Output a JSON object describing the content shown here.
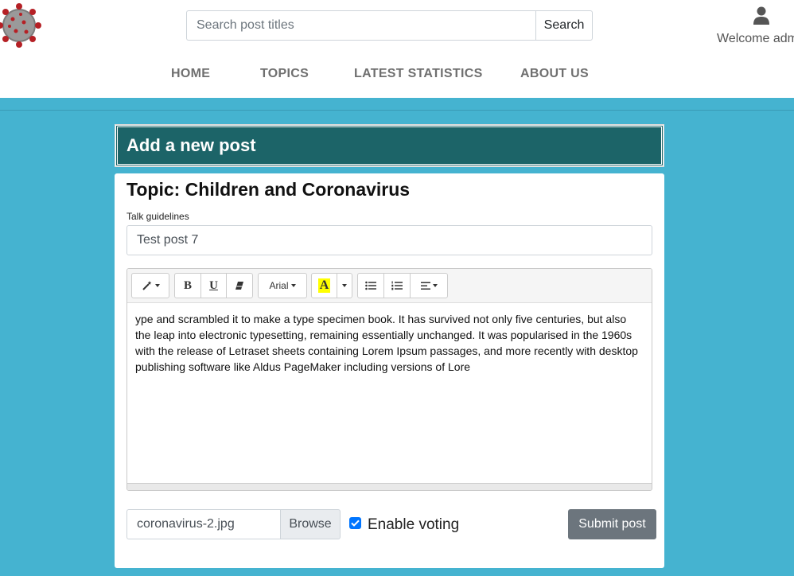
{
  "header": {
    "logo_icon": "coronavirus-logo-icon",
    "search": {
      "placeholder": "Search post titles",
      "value": "",
      "button_label": "Search"
    },
    "user": {
      "icon": "user-icon",
      "welcome_text": "Welcome adm"
    }
  },
  "nav": {
    "items": [
      {
        "label": "HOME"
      },
      {
        "label": "TOPICS"
      },
      {
        "label": "LATEST STATISTICS"
      },
      {
        "label": "ABOUT US"
      }
    ]
  },
  "page": {
    "title": "Add a new post",
    "topic_title": "Topic: Children and Coronavirus",
    "guidelines_label": "Talk guidelines",
    "post_title_value": "Test post 7"
  },
  "editor": {
    "toolbar": {
      "style_icon": "magic-wand-icon",
      "bold_label": "B",
      "underline_label": "U",
      "eraser_icon": "eraser-icon",
      "font_name": "Arial",
      "color_label": "A",
      "highlight_color": "#ffff00",
      "unordered_list_icon": "unordered-list-icon",
      "ordered_list_icon": "ordered-list-icon",
      "align_icon": "align-left-icon"
    },
    "content": "ype and scrambled it to make a type specimen book. It has survived not only five centuries, but also the leap into electronic typesetting, remaining essentially unchanged. It was popularised in the 1960s with the release of Letraset sheets containing Lorem Ipsum passages, and more recently with desktop publishing software like Aldus PageMaker including versions of Lore"
  },
  "footer_form": {
    "file_name": "coronavirus-2.jpg",
    "browse_label": "Browse",
    "voting_label": "Enable voting",
    "voting_checked": true,
    "submit_label": "Submit post"
  },
  "colors": {
    "page_background": "#45b3d0",
    "header_card": "#1c6468",
    "submit_button": "#6c757d",
    "checkbox_accent": "#0075ff"
  }
}
